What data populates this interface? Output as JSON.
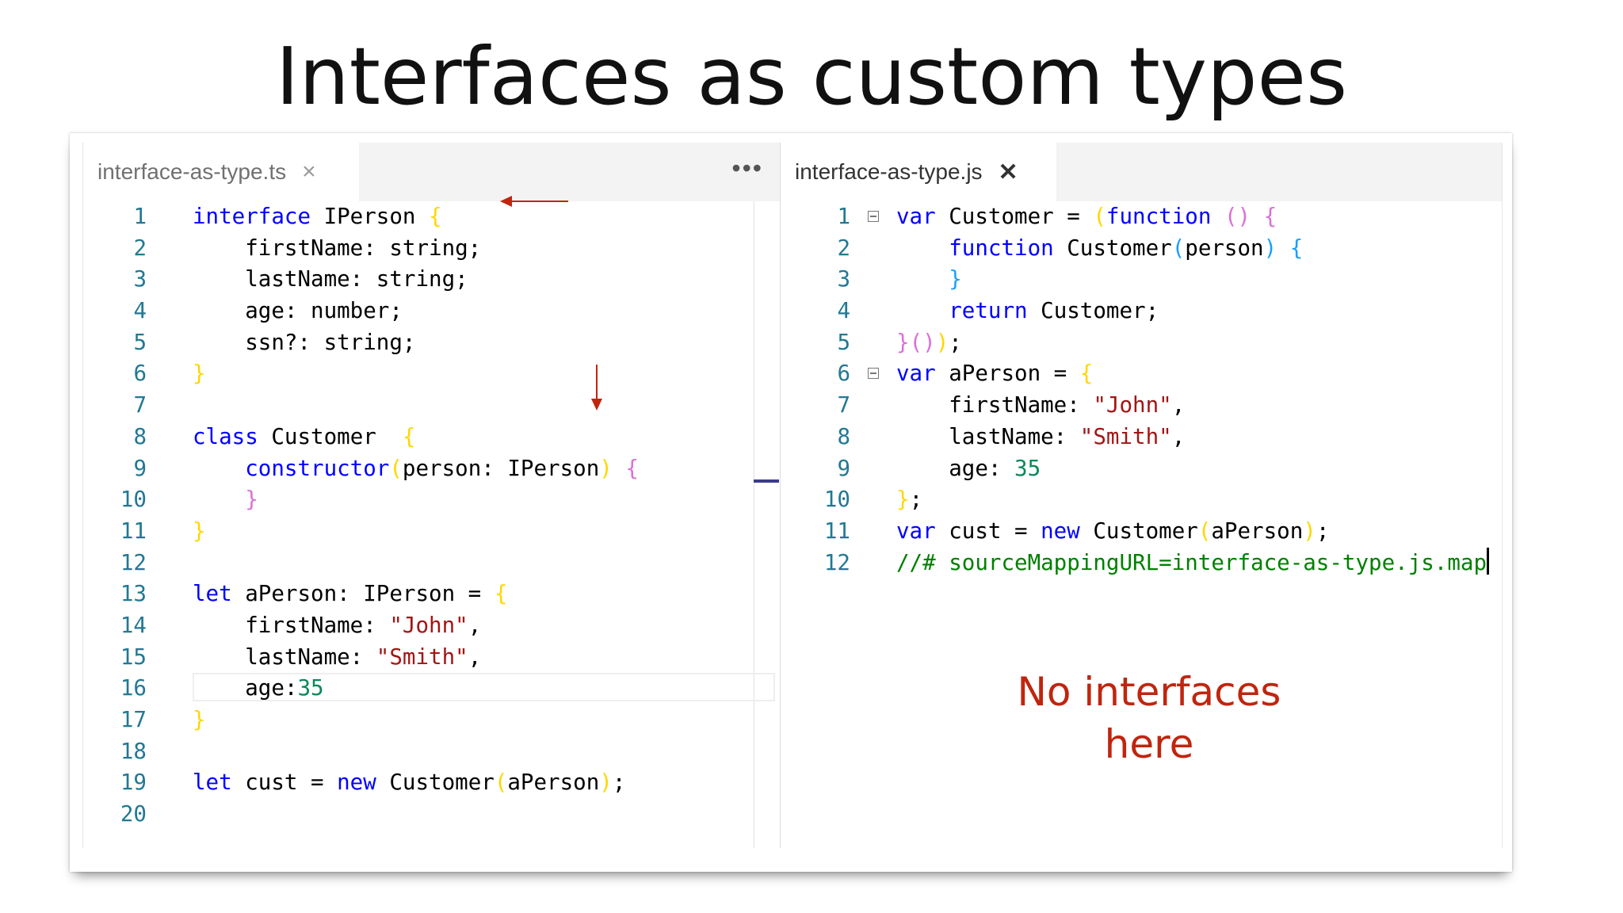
{
  "slide": {
    "title": "Interfaces as custom types",
    "note_line1": "No interfaces",
    "note_line2": "here"
  },
  "colors": {
    "accent_red": "#c0250e",
    "keyword": "#0000ff",
    "string": "#a31515",
    "number": "#09885a",
    "comment": "#008000",
    "line_number": "#237893"
  },
  "left_editor": {
    "tab_label": "interface-as-type.ts",
    "close_icon": "×",
    "more_icon": "•••",
    "line_numbers": [
      "1",
      "2",
      "3",
      "4",
      "5",
      "6",
      "7",
      "8",
      "9",
      "10",
      "11",
      "12",
      "13",
      "14",
      "15",
      "16",
      "17",
      "18",
      "19",
      "20"
    ]
  },
  "right_editor": {
    "tab_label": "interface-as-type.js",
    "close_icon": "✕",
    "line_numbers": [
      "1",
      "2",
      "3",
      "4",
      "5",
      "6",
      "7",
      "8",
      "9",
      "10",
      "11",
      "12"
    ]
  },
  "icons": [
    "close-icon",
    "more-actions-icon",
    "fold-icon",
    "arrow-left-annotation",
    "arrow-down-annotation"
  ]
}
